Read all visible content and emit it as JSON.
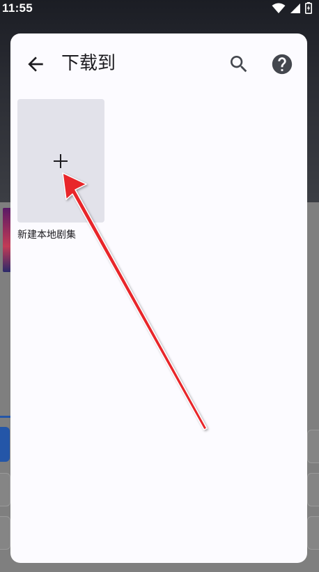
{
  "status_bar": {
    "time": "11:55",
    "icons": [
      "wifi-icon",
      "signal-icon",
      "battery-icon"
    ]
  },
  "dialog": {
    "title": "下载到",
    "icons": {
      "back": "arrow-back-icon",
      "search": "search-icon",
      "help": "help-icon"
    },
    "tiles": [
      {
        "label": "新建本地剧集",
        "icon": "plus-icon"
      }
    ]
  },
  "annotation": {
    "arrow_color": "#e8262a"
  },
  "colors": {
    "dialog_bg": "#fcfbff",
    "tile_bg": "#e2e2ea",
    "text": "#1c1b1f"
  }
}
